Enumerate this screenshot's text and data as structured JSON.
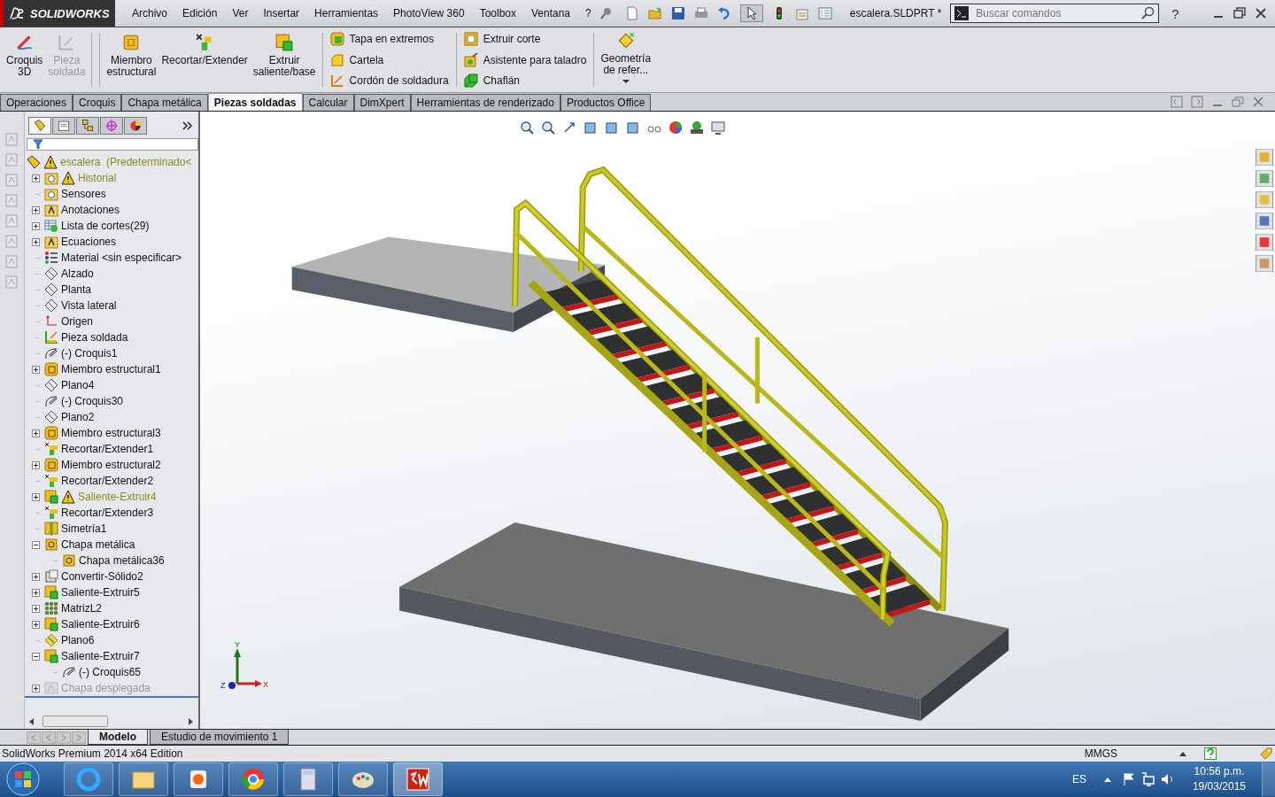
{
  "app": {
    "logo": "SOLIDWORKS",
    "menu": [
      "Archivo",
      "Edición",
      "Ver",
      "Insertar",
      "Herramientas",
      "PhotoView 360",
      "Toolbox",
      "Ventana",
      "?"
    ],
    "document_title": "escalera.SLDPRT *",
    "search": {
      "placeholder": "Buscar comandos"
    },
    "help": "?"
  },
  "ribbon": {
    "large": [
      {
        "label": "Croquis\n3D",
        "kind": "sketch3d",
        "disabled": false
      },
      {
        "label": "Pieza\nsoldada",
        "kind": "weldment",
        "disabled": true
      },
      {
        "label": "Miembro\nestructural",
        "kind": "structural",
        "disabled": false
      },
      {
        "label": "Recortar/Extender",
        "kind": "trim",
        "disabled": false
      },
      {
        "label": "Extruir\nsaliente/base",
        "kind": "extrude",
        "disabled": false
      }
    ],
    "small_columns": [
      [
        {
          "label": "Tapa en extremos",
          "kind": "cap"
        },
        {
          "label": "Cartela",
          "kind": "gusset"
        },
        {
          "label": "Cordón de soldadura",
          "kind": "bead"
        }
      ],
      [
        {
          "label": "Extruir corte",
          "kind": "cut"
        },
        {
          "label": "Asistente para taladro",
          "kind": "hole"
        },
        {
          "label": "Chaflán",
          "kind": "chamfer"
        }
      ]
    ],
    "reference": "Geometría\nde refer..."
  },
  "tabs": [
    {
      "label": "Operaciones",
      "selected": false
    },
    {
      "label": "Croquis",
      "selected": false
    },
    {
      "label": "Chapa metálica",
      "selected": false
    },
    {
      "label": "Piezas soldadas",
      "selected": true
    },
    {
      "label": "Calcular",
      "selected": false
    },
    {
      "label": "DimXpert",
      "selected": false
    },
    {
      "label": "Herramientas de renderizado",
      "selected": false
    },
    {
      "label": "Productos Office",
      "selected": false
    }
  ],
  "tree": {
    "root": {
      "label": "escalera  (Predeterminado<",
      "warning": true
    },
    "items": [
      {
        "label": "Historial",
        "kind": "history",
        "expanded": false,
        "warning": true,
        "suppressed": false
      },
      {
        "label": "Sensores",
        "kind": "sensors",
        "warning": false,
        "suppressed": false
      },
      {
        "label": "Anotaciones",
        "kind": "annotations",
        "expanded": false,
        "warning": false,
        "suppressed": false
      },
      {
        "label": "Lista de cortes(29)",
        "kind": "cutlist",
        "expanded": false,
        "warning": false,
        "suppressed": false
      },
      {
        "label": "Ecuaciones",
        "kind": "equations",
        "expanded": false,
        "warning": false,
        "suppressed": false
      },
      {
        "label": "Material <sin especificar>",
        "kind": "material",
        "warning": false,
        "suppressed": false
      },
      {
        "label": "Alzado",
        "kind": "plane",
        "warning": false,
        "suppressed": false
      },
      {
        "label": "Planta",
        "kind": "plane",
        "warning": false,
        "suppressed": false
      },
      {
        "label": "Vista lateral",
        "kind": "plane",
        "warning": false,
        "suppressed": false
      },
      {
        "label": "Origen",
        "kind": "origin",
        "warning": false,
        "suppressed": false
      },
      {
        "label": "Pieza soldada",
        "kind": "weldment",
        "warning": false,
        "suppressed": false
      },
      {
        "label": "(-) Croquis1",
        "kind": "sketch",
        "warning": false,
        "suppressed": false
      },
      {
        "label": "Miembro estructural1",
        "kind": "structural",
        "expanded": false,
        "warning": false,
        "suppressed": false
      },
      {
        "label": "Plano4",
        "kind": "plane",
        "warning": false,
        "suppressed": false
      },
      {
        "label": "(-) Croquis30",
        "kind": "sketch",
        "warning": false,
        "suppressed": false
      },
      {
        "label": "Plano2",
        "kind": "plane",
        "warning": false,
        "suppressed": false
      },
      {
        "label": "Miembro estructural3",
        "kind": "structural",
        "expanded": false,
        "warning": false,
        "suppressed": false
      },
      {
        "label": "Recortar/Extender1",
        "kind": "trim",
        "warning": false,
        "suppressed": false
      },
      {
        "label": "Miembro estructural2",
        "kind": "structural",
        "expanded": false,
        "warning": false,
        "suppressed": false
      },
      {
        "label": "Recortar/Extender2",
        "kind": "trim",
        "warning": false,
        "suppressed": false
      },
      {
        "label": "Saliente-Extruir4",
        "kind": "extrude",
        "expanded": false,
        "warning": true,
        "suppressed": false
      },
      {
        "label": "Recortar/Extender3",
        "kind": "trim",
        "warning": false,
        "suppressed": false
      },
      {
        "label": "Simetría1",
        "kind": "mirror",
        "warning": false,
        "suppressed": false
      },
      {
        "label": "Chapa metálica",
        "kind": "sheetmetal",
        "expanded": true,
        "warning": false,
        "suppressed": false,
        "children": [
          {
            "label": "Chapa metálica36",
            "kind": "sheetmetal",
            "warning": false,
            "suppressed": false
          }
        ]
      },
      {
        "label": "Convertir-Sólido2",
        "kind": "convert",
        "expanded": false,
        "warning": false,
        "suppressed": false
      },
      {
        "label": "Saliente-Extruir5",
        "kind": "extrude",
        "expanded": false,
        "warning": false,
        "suppressed": false
      },
      {
        "label": "MatrizL2",
        "kind": "pattern",
        "expanded": false,
        "warning": false,
        "suppressed": false
      },
      {
        "label": "Saliente-Extruir6",
        "kind": "extrude",
        "expanded": false,
        "warning": false,
        "suppressed": false
      },
      {
        "label": "Plano6",
        "kind": "plane-active",
        "warning": false,
        "suppressed": false
      },
      {
        "label": "Saliente-Extruir7",
        "kind": "extrude",
        "expanded": true,
        "warning": false,
        "suppressed": false,
        "children": [
          {
            "label": "(-) Croquis65",
            "kind": "sketch",
            "warning": false,
            "suppressed": false
          }
        ]
      },
      {
        "label": "Chapa desplegada",
        "kind": "flat",
        "expanded": false,
        "warning": false,
        "suppressed": true
      }
    ]
  },
  "triad": {
    "x": "X",
    "y": "Y",
    "z": "Z"
  },
  "bottom_tabs": [
    {
      "label": "Modelo",
      "selected": true
    },
    {
      "label": "Estudio de movimiento 1",
      "selected": false
    }
  ],
  "status_bar": {
    "edition": "SolidWorks Premium 2014 x64 Edition",
    "units": "MMGS"
  },
  "taskbar": {
    "language": "ES",
    "time": "10:56 p.m.",
    "date": "19/03/2015"
  }
}
